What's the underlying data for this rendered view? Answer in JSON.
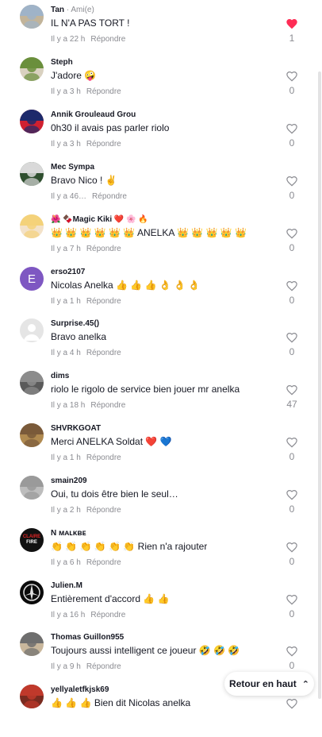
{
  "comments": [
    {
      "user": "Tan",
      "tag": "· Ami(e)",
      "text": "IL N'A PAS TORT !",
      "time": "Il y a 22 h",
      "reply": "Répondre",
      "likes": "1",
      "liked": true
    },
    {
      "user": "Steph",
      "tag": "",
      "text": "J'adore 🤪",
      "time": "Il y a 3 h",
      "reply": "Répondre",
      "likes": "0",
      "liked": false
    },
    {
      "user": "Annik Grouleaud Grou",
      "tag": "",
      "text": "0h30 il avais pas parler riolo",
      "time": "Il y a 3 h",
      "reply": "Répondre",
      "likes": "0",
      "liked": false
    },
    {
      "user": "Mec Sympa",
      "tag": "",
      "text": "Bravo Nico ! ✌️",
      "time": "Il y a 46…",
      "reply": "Répondre",
      "likes": "0",
      "liked": false
    },
    {
      "user": "🌺 🍫Magic Kiki ❤️ 🌸 🔥",
      "tag": "",
      "text": "👑 👑 👑 👑 👑 👑  ANELKA 👑 👑 👑 👑 👑",
      "time": "Il y a 7 h",
      "reply": "Répondre",
      "likes": "0",
      "liked": false
    },
    {
      "user": "erso2107",
      "tag": "",
      "text": "Nicolas Anelka 👍 👍 👍 👌 👌 👌",
      "time": "Il y a 1 h",
      "reply": "Répondre",
      "likes": "0",
      "liked": false
    },
    {
      "user": "Surprise.45()",
      "tag": "",
      "text": "Bravo anelka",
      "time": "Il y a 4 h",
      "reply": "Répondre",
      "likes": "0",
      "liked": false
    },
    {
      "user": "dims",
      "tag": "",
      "text": "riolo le rigolo de service bien jouer mr anelka",
      "time": "Il y a 18 h",
      "reply": "Répondre",
      "likes": "47",
      "liked": false
    },
    {
      "user": "SHVRKGOAT",
      "tag": "",
      "text": "Merci ANELKA Soldat ❤️ 💙",
      "time": "Il y a 1 h",
      "reply": "Répondre",
      "likes": "0",
      "liked": false
    },
    {
      "user": "smain209",
      "tag": "",
      "text": "Oui, tu dois être bien le seul…",
      "time": "Il y a 2 h",
      "reply": "Répondre",
      "likes": "0",
      "liked": false
    },
    {
      "user": "N ᴍᴀʟᴋʙᴇ",
      "tag": "",
      "text": "👏 👏 👏 👏 👏 👏  Rien n'a rajouter",
      "time": "Il y a 6 h",
      "reply": "Répondre",
      "likes": "0",
      "liked": false
    },
    {
      "user": "Julien.M",
      "tag": "",
      "text": "Entièrement d'accord 👍 👍",
      "time": "Il y a 16 h",
      "reply": "Répondre",
      "likes": "0",
      "liked": false
    },
    {
      "user": "Thomas Guillon955",
      "tag": "",
      "text": "Toujours aussi intelligent ce joueur 🤣 🤣 🤣",
      "time": "Il y a 9 h",
      "reply": "Répondre",
      "likes": "0",
      "liked": false
    },
    {
      "user": "yellyaletfkjsk69",
      "tag": "",
      "text": "👍 👍 👍 Bien dit Nicolas anelka",
      "time": "",
      "reply": "",
      "likes": "",
      "liked": false
    }
  ],
  "avatars": [
    {
      "kind": "photo",
      "colors": [
        "#9fb3c8",
        "#c2b49a"
      ]
    },
    {
      "kind": "photo",
      "colors": [
        "#6a8f3c",
        "#d9d1c0"
      ]
    },
    {
      "kind": "photo",
      "colors": [
        "#1d2a6b",
        "#d02030"
      ]
    },
    {
      "kind": "photo",
      "colors": [
        "#d9d9d9",
        "#2f4f2f"
      ]
    },
    {
      "kind": "photo",
      "colors": [
        "#f4d27a",
        "#f3e2c9"
      ]
    },
    {
      "kind": "letter",
      "letter": "E",
      "colors": [
        "#7e57c2",
        "#7e57c2"
      ]
    },
    {
      "kind": "default",
      "colors": [
        "#e5e5e5",
        "#e5e5e5"
      ]
    },
    {
      "kind": "photo",
      "colors": [
        "#8c8c8c",
        "#5a5a5a"
      ]
    },
    {
      "kind": "photo",
      "colors": [
        "#7a5a3a",
        "#b08a50"
      ]
    },
    {
      "kind": "photo",
      "colors": [
        "#9a9a9a",
        "#bdbdbd"
      ]
    },
    {
      "kind": "badge",
      "label": "CLAIRE FIRE",
      "colors": [
        "#111111",
        "#e02424"
      ]
    },
    {
      "kind": "emblem",
      "colors": [
        "#0b0b0b",
        "#e0e0e0"
      ]
    },
    {
      "kind": "photo",
      "colors": [
        "#6e6e6e",
        "#c9b79c"
      ]
    },
    {
      "kind": "photo",
      "colors": [
        "#c0392b",
        "#7a2b20"
      ]
    }
  ],
  "like_colors": {
    "liked": "#fe2c55",
    "outline": "#8a8b91"
  },
  "back_to_top": {
    "label": "Retour en haut",
    "icon": "chevrons-up-icon"
  }
}
